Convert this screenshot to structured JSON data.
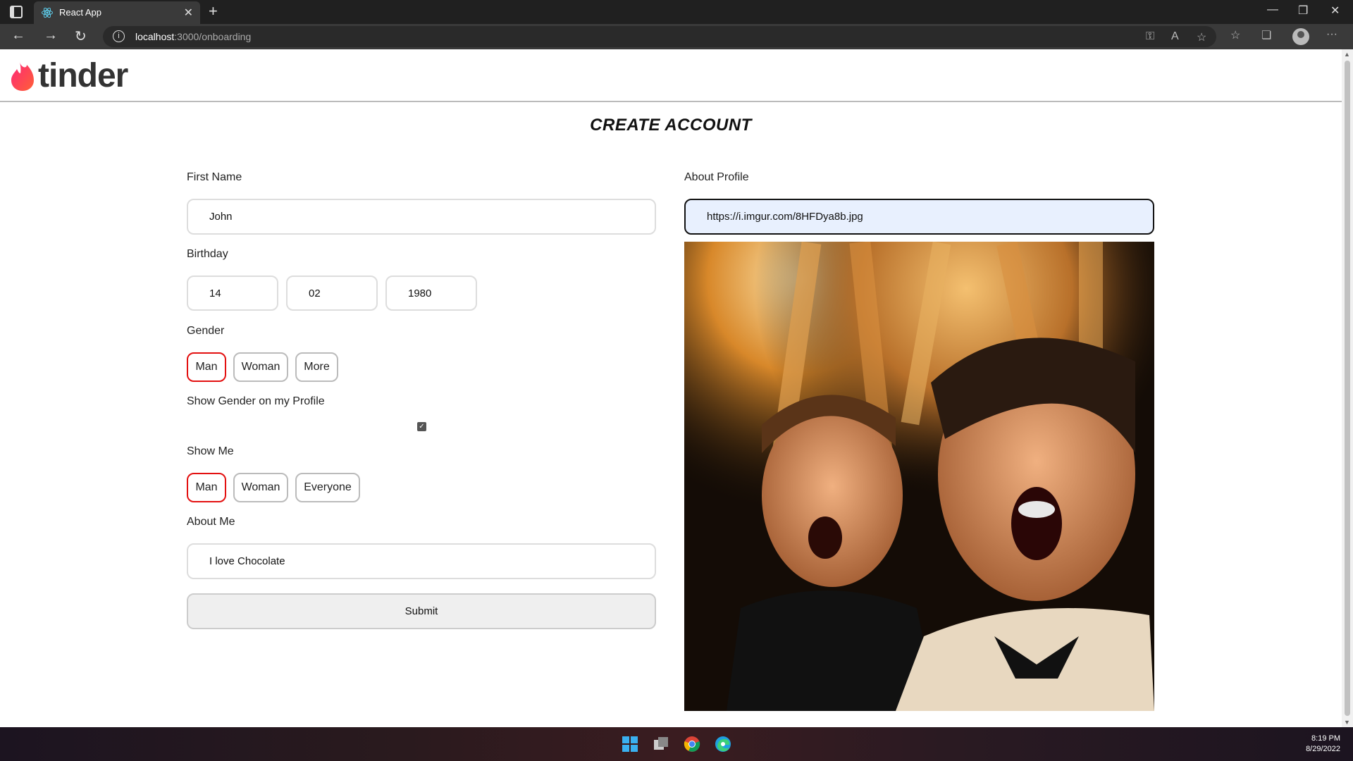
{
  "browser": {
    "tab_title": "React App",
    "tab_close": "✕",
    "new_tab": "+",
    "url_host": "localhost",
    "url_path": ":3000/onboarding",
    "window_controls": [
      "—",
      "❐",
      "✕"
    ]
  },
  "header": {
    "logo_text": "tinder",
    "logo_color": "#fd5564"
  },
  "page": {
    "title": "CREATE ACCOUNT"
  },
  "form": {
    "first_name": {
      "label": "First Name",
      "value": "John"
    },
    "birthday": {
      "label": "Birthday",
      "day": "14",
      "month": "02",
      "year": "1980"
    },
    "gender": {
      "label": "Gender",
      "options": [
        "Man",
        "Woman",
        "More"
      ],
      "selected": "Man"
    },
    "show_gender": {
      "label": "Show Gender on my Profile",
      "checked": true,
      "check_glyph": "✓"
    },
    "show_me": {
      "label": "Show Me",
      "options": [
        "Man",
        "Woman",
        "Everyone"
      ],
      "selected": "Man"
    },
    "about_me": {
      "label": "About Me",
      "value": "I love Chocolate"
    },
    "submit_label": "Submit",
    "about_profile": {
      "label": "About Profile",
      "url_value": "https://i.imgur.com/8HFDya8b.jpg"
    }
  },
  "taskbar": {
    "time": "8:19 PM",
    "date": "8/29/2022"
  },
  "colors": {
    "selected_border": "#e31010",
    "accent_flame": "#fd5564"
  }
}
